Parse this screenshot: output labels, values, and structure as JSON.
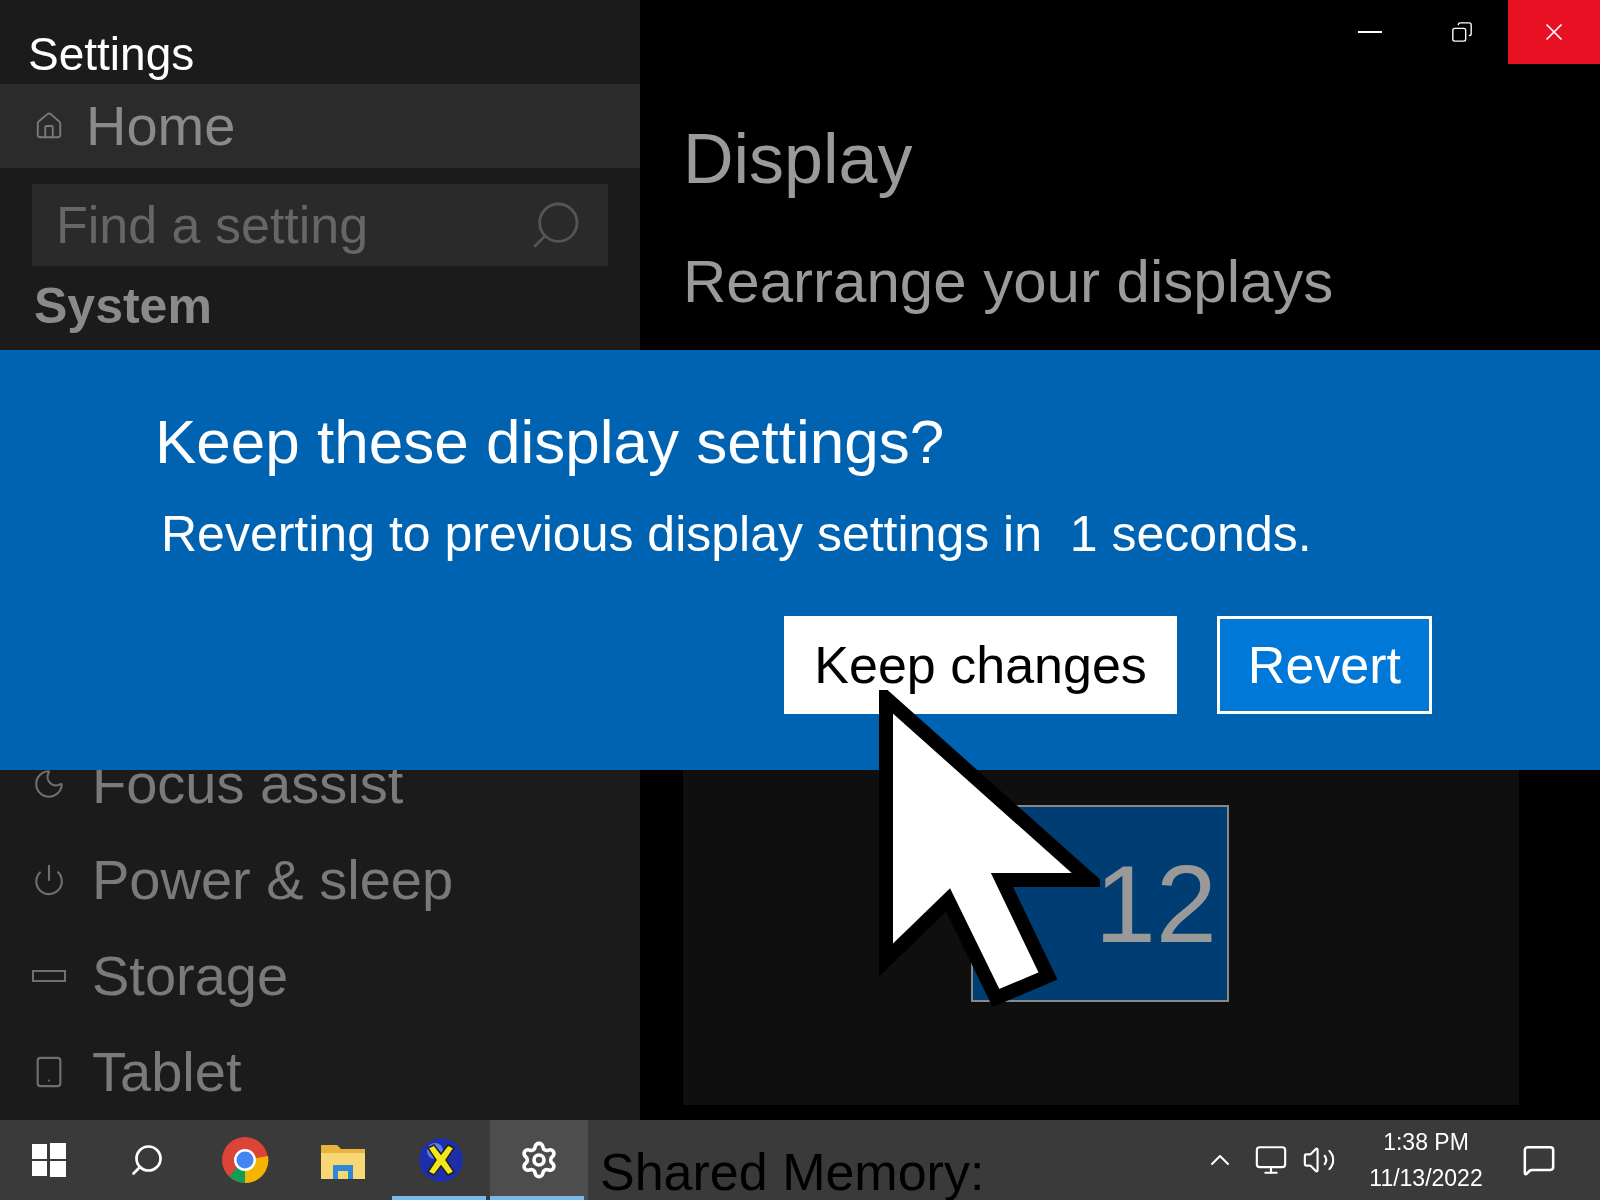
{
  "window": {
    "title": "Settings"
  },
  "sidebar": {
    "home": "Home",
    "search": {
      "placeholder": "Find a setting"
    },
    "section": "System",
    "items": [
      {
        "label": "Focus assist",
        "kind": "focus"
      },
      {
        "label": "Power & sleep",
        "kind": "power"
      },
      {
        "label": "Storage",
        "kind": "storage"
      },
      {
        "label": "Tablet",
        "kind": "tablet"
      }
    ]
  },
  "main": {
    "title": "Display",
    "subtitle": "Rearrange your displays",
    "monitors": [
      "1",
      "2"
    ]
  },
  "dialog": {
    "title": "Keep these display settings?",
    "message": "Reverting to previous display settings in  1 seconds.",
    "buttons": [
      {
        "label": "Keep changes",
        "kind": "primary"
      },
      {
        "label": "Revert",
        "kind": "secondary"
      }
    ]
  },
  "background_text": "Shared Memory:",
  "taskbar": {
    "apps": [
      {
        "kind": "start",
        "running": false,
        "selected": false
      },
      {
        "kind": "search",
        "running": false,
        "selected": false
      },
      {
        "kind": "chrome",
        "running": false,
        "selected": false
      },
      {
        "kind": "explorer",
        "running": false,
        "selected": false
      },
      {
        "kind": "xapp",
        "running": true,
        "selected": false
      },
      {
        "kind": "settings",
        "running": true,
        "selected": true
      }
    ],
    "time": "1:38 PM",
    "date": "11/13/2022"
  }
}
